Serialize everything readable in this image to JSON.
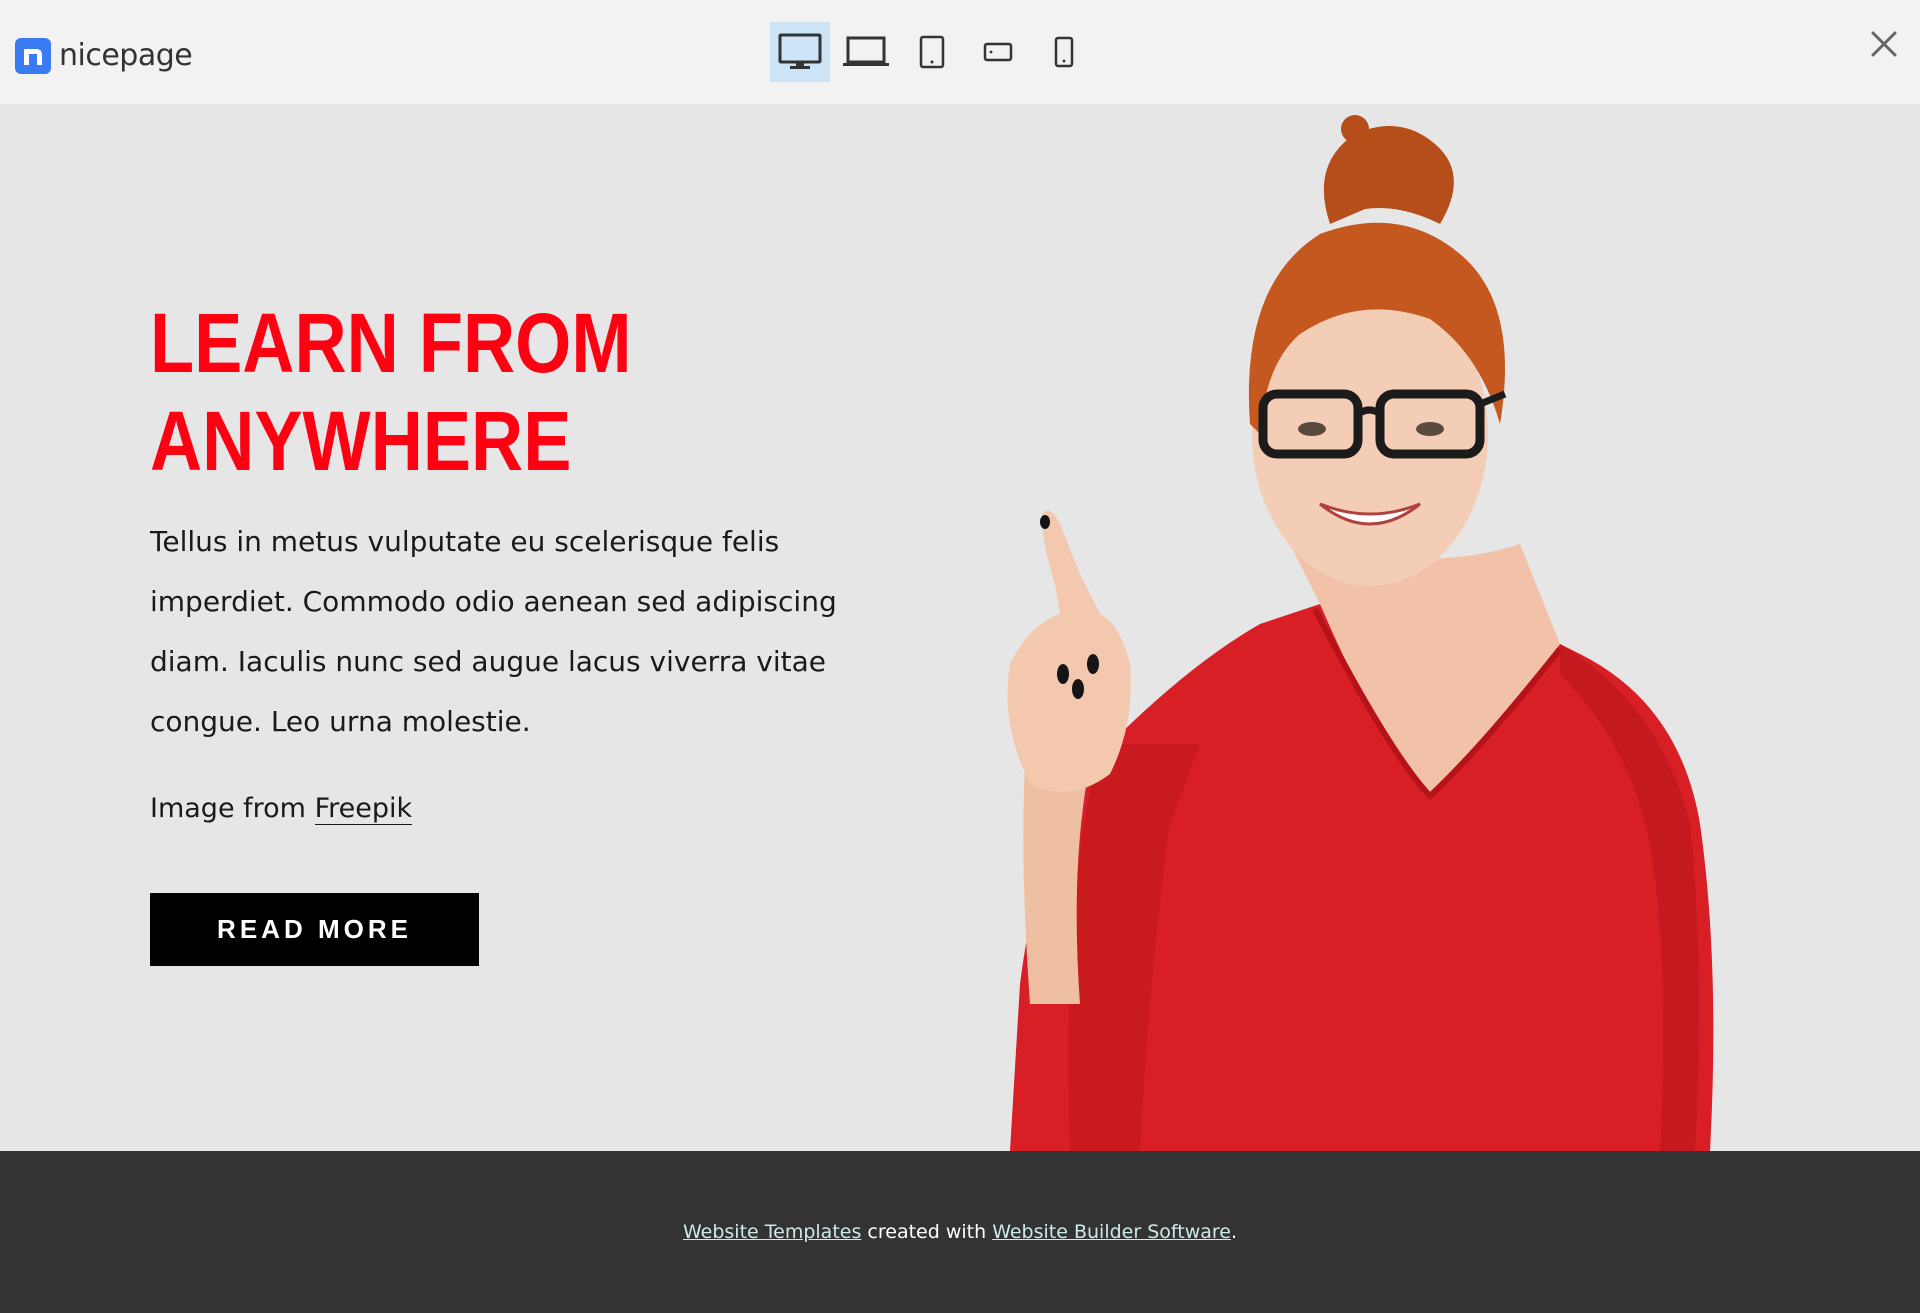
{
  "brand": {
    "name": "nicepage",
    "accent": "#3a7bf3"
  },
  "toolbar": {
    "devices": [
      {
        "name": "desktop",
        "active": true
      },
      {
        "name": "laptop",
        "active": false
      },
      {
        "name": "tablet",
        "active": false
      },
      {
        "name": "tablet-landscape",
        "active": false
      },
      {
        "name": "phone",
        "active": false
      }
    ],
    "close_icon": "close-icon"
  },
  "hero": {
    "heading_line1": "LEARN FROM",
    "heading_line2": "ANYWHERE",
    "body": "Tellus in metus vulputate eu scelerisque felis imperdiet. Commodo odio aenean sed adipiscing diam. Iaculis nunc sed augue lacus viverra vitae congue. Leo urna molestie.",
    "credit_prefix": "Image from ",
    "credit_link": "Freepik",
    "button_label": "READ MORE",
    "heading_color": "#ff0012"
  },
  "footer": {
    "link1": "Website Templates",
    "middle": " created with ",
    "link2": "Website Builder Software",
    "suffix": "."
  }
}
